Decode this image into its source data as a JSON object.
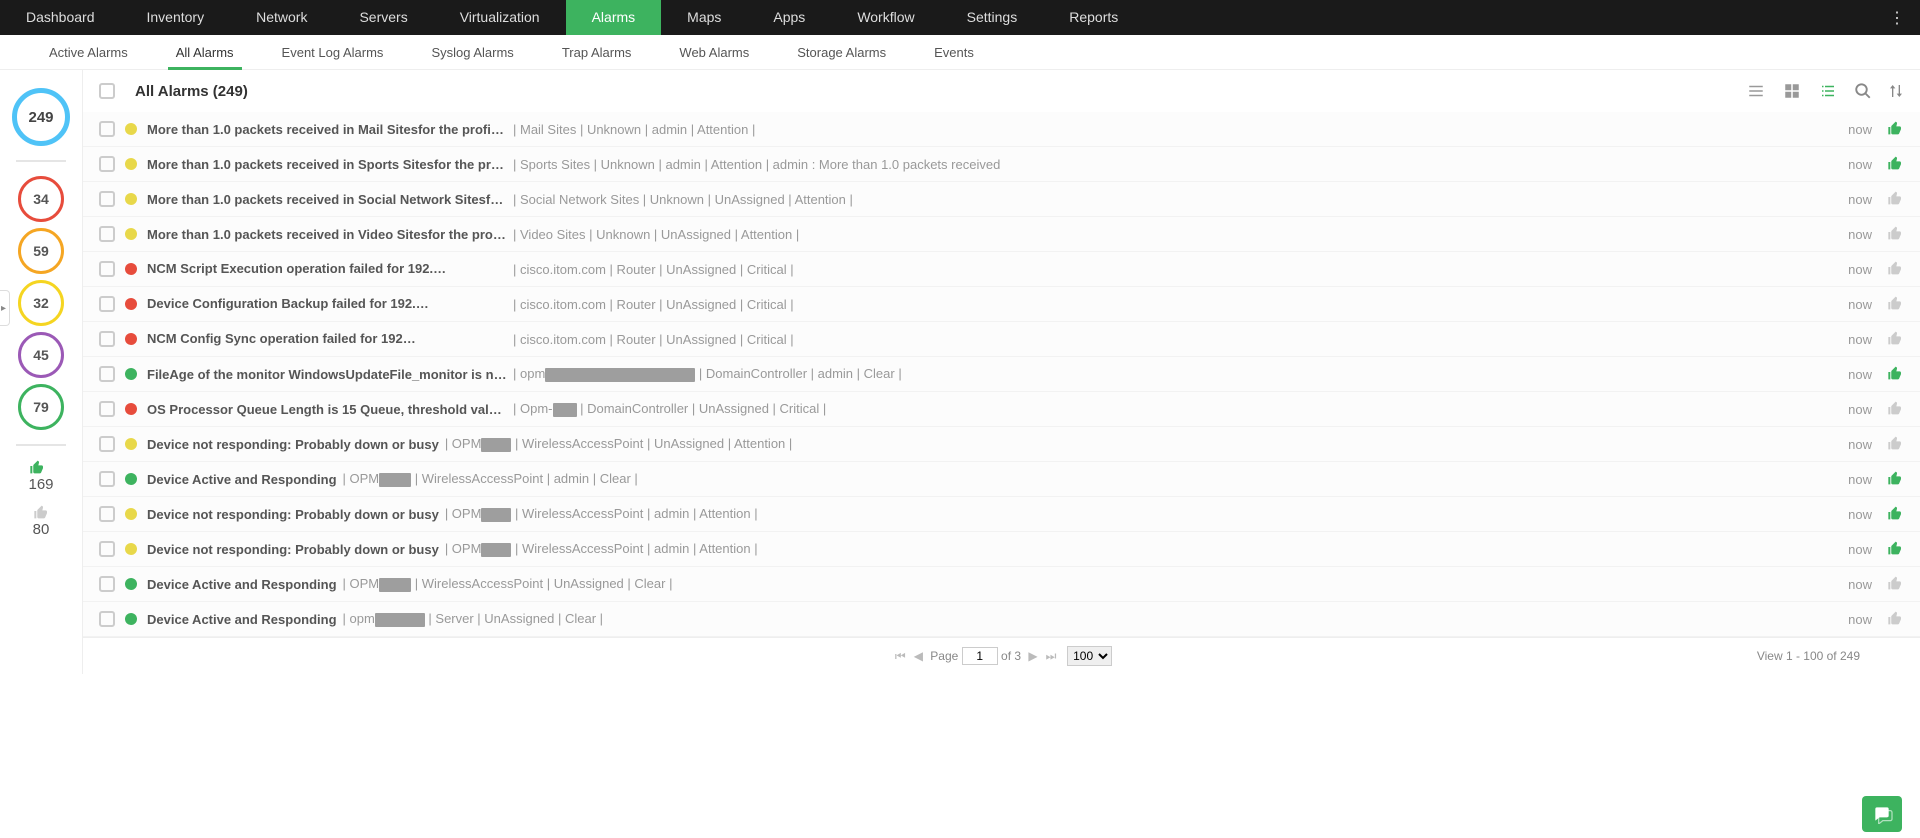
{
  "topnav": [
    "Dashboard",
    "Inventory",
    "Network",
    "Servers",
    "Virtualization",
    "Alarms",
    "Maps",
    "Apps",
    "Workflow",
    "Settings",
    "Reports"
  ],
  "topnav_active": 5,
  "subnav": [
    "Active Alarms",
    "All Alarms",
    "Event Log Alarms",
    "Syslog Alarms",
    "Trap Alarms",
    "Web Alarms",
    "Storage Alarms",
    "Events"
  ],
  "subnav_active": 1,
  "title": "All Alarms (249)",
  "sidebar": {
    "total": "249",
    "stats": [
      {
        "value": "34",
        "cls": "c-red"
      },
      {
        "value": "59",
        "cls": "c-orange"
      },
      {
        "value": "32",
        "cls": "c-yellow"
      },
      {
        "value": "45",
        "cls": "c-purple"
      },
      {
        "value": "79",
        "cls": "c-green"
      }
    ],
    "ack_on": "169",
    "ack_off": "80"
  },
  "alarms": [
    {
      "sev": "sev-yellow",
      "msg": "More than 1.0 packets received in Mail Sitesfor the profile[...",
      "meta": " | Mail Sites | Unknown | admin | Attention | ",
      "time": "now",
      "ack": true
    },
    {
      "sev": "sev-yellow",
      "msg": "More than 1.0 packets received in Sports Sitesfor the profi...",
      "meta": " | Sports Sites | Unknown | admin | Attention | admin : More than 1.0 packets received",
      "time": "now",
      "ack": true
    },
    {
      "sev": "sev-yellow",
      "msg": "More than 1.0 packets received in Social Network Sitesfor ...",
      "meta": " | Social Network Sites | Unknown | UnAssigned | Attention | ",
      "time": "now",
      "ack": false
    },
    {
      "sev": "sev-yellow",
      "msg": "More than 1.0 packets received in Video Sitesfor the profil...",
      "meta": " | Video Sites | Unknown | UnAssigned | Attention | ",
      "time": "now",
      "ack": false
    },
    {
      "sev": "sev-red",
      "msg": "NCM Script Execution operation failed for 192.",
      "redact1": 78,
      "meta": " | cisco.itom.com | Router | UnAssigned | Critical | ",
      "time": "now",
      "ack": false
    },
    {
      "sev": "sev-red",
      "msg": "Device Configuration Backup failed for 192.",
      "redact1": 100,
      "meta": " | cisco.itom.com | Router | UnAssigned | Critical | ",
      "time": "now",
      "ack": false
    },
    {
      "sev": "sev-red",
      "msg": "NCM Config Sync operation failed for 192",
      "redact1": 112,
      "meta": " | cisco.itom.com | Router | UnAssigned | Critical | ",
      "time": "now",
      "ack": false
    },
    {
      "sev": "sev-green",
      "msg": "FileAge of the monitor WindowsUpdateFile_monitor is no...",
      "meta_pre": " | opm",
      "redact2": 150,
      "meta": " | DomainController | admin | Clear | ",
      "time": "now",
      "ack": true
    },
    {
      "sev": "sev-red",
      "msg": "OS Processor Queue Length is 15 Queue, threshold value f...",
      "meta_pre": " | Opm-",
      "redact2": 24,
      "meta": " | DomainController | UnAssigned | Critical | ",
      "time": "now",
      "ack": false
    },
    {
      "sev": "sev-yellow",
      "msg": "Device not responding: Probably down or busy",
      "meta_pre": " | OPM",
      "redact2": 30,
      "meta": " | WirelessAccessPoint | UnAssigned | Attention | ",
      "time": "now",
      "ack": false
    },
    {
      "sev": "sev-green",
      "msg": "Device Active and Responding",
      "meta_pre": " | OPM",
      "redact2": 32,
      "meta": " | WirelessAccessPoint | admin | Clear | ",
      "time": "now",
      "ack": true
    },
    {
      "sev": "sev-yellow",
      "msg": "Device not responding: Probably down or busy",
      "meta_pre": " | OPM",
      "redact2": 30,
      "meta": " | WirelessAccessPoint | admin | Attention | ",
      "time": "now",
      "ack": true
    },
    {
      "sev": "sev-yellow",
      "msg": "Device not responding: Probably down or busy",
      "meta_pre": " | OPM",
      "redact2": 30,
      "meta": " | WirelessAccessPoint | admin | Attention | ",
      "time": "now",
      "ack": true
    },
    {
      "sev": "sev-green",
      "msg": "Device Active and Responding",
      "meta_pre": " | OPM",
      "redact2": 32,
      "meta": " | WirelessAccessPoint | UnAssigned | Clear | ",
      "time": "now",
      "ack": false
    },
    {
      "sev": "sev-green",
      "msg": "Device Active and Responding",
      "meta_pre": " | opm",
      "redact2": 50,
      "meta": " | Server | UnAssigned | Clear | ",
      "time": "now",
      "ack": false
    }
  ],
  "pager": {
    "label_page": "Page",
    "page": "1",
    "of": "of 3",
    "pagesize": "100",
    "info": "View 1 - 100 of 249"
  }
}
